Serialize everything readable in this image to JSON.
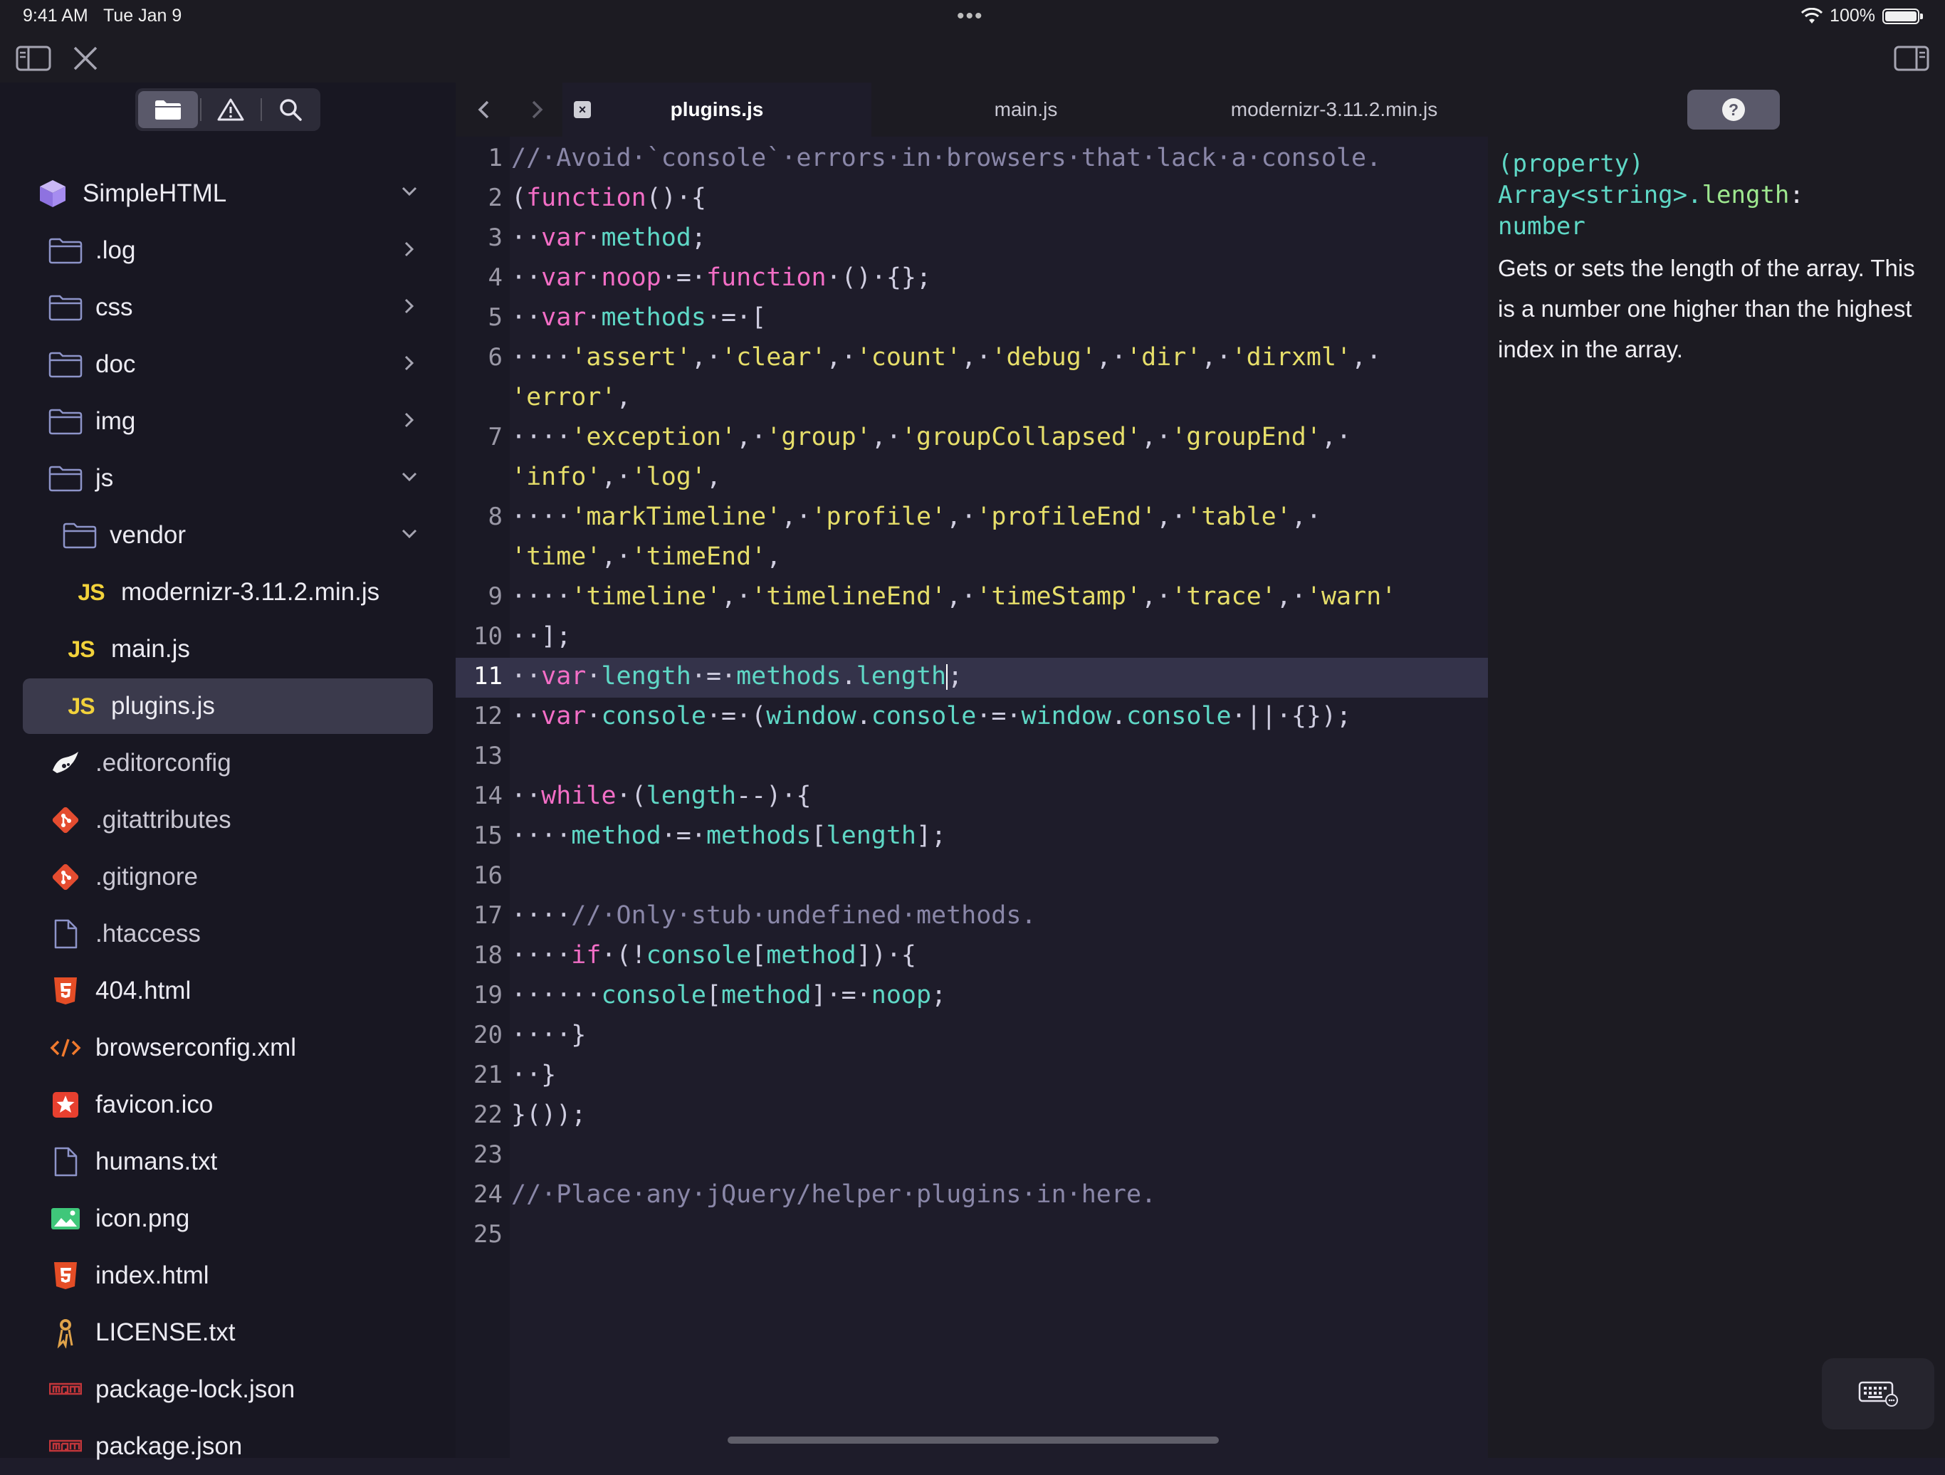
{
  "status": {
    "time": "9:41 AM",
    "date": "Tue Jan 9",
    "dots": "•••",
    "battery": "100%",
    "battery_level": 1.0
  },
  "toolbar": {
    "left_icons": [
      "sidebar-toggle-icon",
      "close-icon"
    ],
    "right_icons": [
      "right-panel-toggle-icon"
    ]
  },
  "sidebar": {
    "tabs": [
      {
        "icon": "folder-icon",
        "active": true
      },
      {
        "icon": "warning-icon",
        "active": false
      },
      {
        "icon": "search-icon",
        "active": false
      }
    ],
    "project": "SimpleHTML",
    "tree": [
      {
        "label": ".log",
        "icon": "folder-icon",
        "indent": 0,
        "chevron": "right"
      },
      {
        "label": "css",
        "icon": "folder-icon",
        "indent": 0,
        "chevron": "right"
      },
      {
        "label": "doc",
        "icon": "folder-icon",
        "indent": 0,
        "chevron": "right"
      },
      {
        "label": "img",
        "icon": "folder-icon",
        "indent": 0,
        "chevron": "right"
      },
      {
        "label": "js",
        "icon": "folder-icon",
        "indent": 0,
        "chevron": "down"
      },
      {
        "label": "vendor",
        "icon": "folder-icon",
        "indent": 1,
        "chevron": "down"
      },
      {
        "label": "modernizr-3.11.2.min.js",
        "icon": "js-file-icon",
        "indent": 2
      },
      {
        "label": "main.js",
        "icon": "js-file-icon",
        "indent": 1
      },
      {
        "label": "plugins.js",
        "icon": "js-file-icon",
        "indent": 1,
        "selected": true
      },
      {
        "label": ".editorconfig",
        "icon": "editorconfig-icon",
        "indent": 0,
        "dim": true
      },
      {
        "label": ".gitattributes",
        "icon": "git-icon",
        "indent": 0,
        "dim": true
      },
      {
        "label": ".gitignore",
        "icon": "git-icon",
        "indent": 0,
        "dim": true
      },
      {
        "label": ".htaccess",
        "icon": "file-icon",
        "indent": 0,
        "dim": true
      },
      {
        "label": "404.html",
        "icon": "html5-icon",
        "indent": 0
      },
      {
        "label": "browserconfig.xml",
        "icon": "xml-icon",
        "indent": 0
      },
      {
        "label": "favicon.ico",
        "icon": "favicon-icon",
        "indent": 0
      },
      {
        "label": "humans.txt",
        "icon": "file-icon",
        "indent": 0
      },
      {
        "label": "icon.png",
        "icon": "image-icon",
        "indent": 0
      },
      {
        "label": "index.html",
        "icon": "html5-icon",
        "indent": 0
      },
      {
        "label": "LICENSE.txt",
        "icon": "license-icon",
        "indent": 0
      },
      {
        "label": "package-lock.json",
        "icon": "npm-icon",
        "indent": 0
      },
      {
        "label": "package.json",
        "icon": "npm-icon",
        "indent": 0
      }
    ]
  },
  "editor": {
    "nav_icons": [
      "back-icon",
      "forward-icon"
    ],
    "tabs": [
      {
        "label": "plugins.js",
        "active": true,
        "close": "×"
      },
      {
        "label": "main.js",
        "active": false
      },
      {
        "label": "modernizr-3.11.2.min.js",
        "active": false
      }
    ],
    "current_line": 11,
    "lines": [
      {
        "n": "1",
        "tokens": [
          [
            "cmt",
            "//·Avoid·`console`·errors·in·browsers·that·lack·a·console."
          ]
        ]
      },
      {
        "n": "2",
        "tokens": [
          [
            "op",
            "("
          ],
          [
            "fn",
            "function"
          ],
          [
            "op",
            "()·{"
          ]
        ]
      },
      {
        "n": "3",
        "tokens": [
          [
            "op",
            "··"
          ],
          [
            "kw",
            "var"
          ],
          [
            "op",
            "·"
          ],
          [
            "ident",
            "method"
          ],
          [
            "op",
            ";"
          ]
        ]
      },
      {
        "n": "4",
        "tokens": [
          [
            "op",
            "··"
          ],
          [
            "kw",
            "var"
          ],
          [
            "op",
            "·"
          ],
          [
            "fn",
            "noop"
          ],
          [
            "op",
            "·=·"
          ],
          [
            "fn",
            "function"
          ],
          [
            "op",
            "·()·{};"
          ]
        ]
      },
      {
        "n": "5",
        "tokens": [
          [
            "op",
            "··"
          ],
          [
            "kw",
            "var"
          ],
          [
            "op",
            "·"
          ],
          [
            "ident",
            "methods"
          ],
          [
            "op",
            "·=·["
          ]
        ]
      },
      {
        "n": "6",
        "tokens": [
          [
            "op",
            "····"
          ],
          [
            "str",
            "'assert'"
          ],
          [
            "op",
            ",·"
          ],
          [
            "str",
            "'clear'"
          ],
          [
            "op",
            ",·"
          ],
          [
            "str",
            "'count'"
          ],
          [
            "op",
            ",·"
          ],
          [
            "str",
            "'debug'"
          ],
          [
            "op",
            ",·"
          ],
          [
            "str",
            "'dir'"
          ],
          [
            "op",
            ",·"
          ],
          [
            "str",
            "'dirxml'"
          ],
          [
            "op",
            ",·"
          ]
        ]
      },
      {
        "n": "",
        "tokens": [
          [
            "str",
            "'error'"
          ],
          [
            "op",
            ","
          ]
        ]
      },
      {
        "n": "7",
        "tokens": [
          [
            "op",
            "····"
          ],
          [
            "str",
            "'exception'"
          ],
          [
            "op",
            ",·"
          ],
          [
            "str",
            "'group'"
          ],
          [
            "op",
            ",·"
          ],
          [
            "str",
            "'groupCollapsed'"
          ],
          [
            "op",
            ",·"
          ],
          [
            "str",
            "'groupEnd'"
          ],
          [
            "op",
            ",·"
          ]
        ]
      },
      {
        "n": "",
        "tokens": [
          [
            "str",
            "'info'"
          ],
          [
            "op",
            ",·"
          ],
          [
            "str",
            "'log'"
          ],
          [
            "op",
            ","
          ]
        ]
      },
      {
        "n": "8",
        "tokens": [
          [
            "op",
            "····"
          ],
          [
            "str",
            "'markTimeline'"
          ],
          [
            "op",
            ",·"
          ],
          [
            "str",
            "'profile'"
          ],
          [
            "op",
            ",·"
          ],
          [
            "str",
            "'profileEnd'"
          ],
          [
            "op",
            ",·"
          ],
          [
            "str",
            "'table'"
          ],
          [
            "op",
            ",·"
          ]
        ]
      },
      {
        "n": "",
        "tokens": [
          [
            "str",
            "'time'"
          ],
          [
            "op",
            ",·"
          ],
          [
            "str",
            "'timeEnd'"
          ],
          [
            "op",
            ","
          ]
        ]
      },
      {
        "n": "9",
        "tokens": [
          [
            "op",
            "····"
          ],
          [
            "str",
            "'timeline'"
          ],
          [
            "op",
            ",·"
          ],
          [
            "str",
            "'timelineEnd'"
          ],
          [
            "op",
            ",·"
          ],
          [
            "str",
            "'timeStamp'"
          ],
          [
            "op",
            ",·"
          ],
          [
            "str",
            "'trace'"
          ],
          [
            "op",
            ",·"
          ],
          [
            "str",
            "'warn'"
          ]
        ]
      },
      {
        "n": "10",
        "tokens": [
          [
            "op",
            "··];"
          ]
        ]
      },
      {
        "n": "11",
        "tokens": [
          [
            "op",
            "··"
          ],
          [
            "kw",
            "var"
          ],
          [
            "op",
            "·"
          ],
          [
            "ident",
            "length"
          ],
          [
            "op",
            "·=·"
          ],
          [
            "ident",
            "methods"
          ],
          [
            "op",
            "."
          ],
          [
            "ident",
            "length"
          ],
          [
            "cursor",
            ""
          ],
          [
            "op",
            ";"
          ]
        ],
        "current": true
      },
      {
        "n": "12",
        "tokens": [
          [
            "op",
            "··"
          ],
          [
            "kw",
            "var"
          ],
          [
            "op",
            "·"
          ],
          [
            "ident",
            "console"
          ],
          [
            "op",
            "·=·("
          ],
          [
            "ident",
            "window"
          ],
          [
            "op",
            "."
          ],
          [
            "ident",
            "console"
          ],
          [
            "op",
            "·=·"
          ],
          [
            "ident",
            "window"
          ],
          [
            "op",
            "."
          ],
          [
            "ident",
            "console"
          ],
          [
            "op",
            "·||·{});"
          ]
        ]
      },
      {
        "n": "13",
        "tokens": []
      },
      {
        "n": "14",
        "tokens": [
          [
            "op",
            "··"
          ],
          [
            "kw",
            "while"
          ],
          [
            "op",
            "·("
          ],
          [
            "ident",
            "length"
          ],
          [
            "op",
            "--)·{"
          ]
        ]
      },
      {
        "n": "15",
        "tokens": [
          [
            "op",
            "····"
          ],
          [
            "ident",
            "method"
          ],
          [
            "op",
            "·=·"
          ],
          [
            "ident",
            "methods"
          ],
          [
            "op",
            "["
          ],
          [
            "ident",
            "length"
          ],
          [
            "op",
            "];"
          ]
        ]
      },
      {
        "n": "16",
        "tokens": []
      },
      {
        "n": "17",
        "tokens": [
          [
            "op",
            "····"
          ],
          [
            "cmt",
            "//·Only·stub·undefined·methods."
          ]
        ]
      },
      {
        "n": "18",
        "tokens": [
          [
            "op",
            "····"
          ],
          [
            "kw",
            "if"
          ],
          [
            "op",
            "·(!"
          ],
          [
            "ident",
            "console"
          ],
          [
            "op",
            "["
          ],
          [
            "ident",
            "method"
          ],
          [
            "op",
            "])·{"
          ]
        ]
      },
      {
        "n": "19",
        "tokens": [
          [
            "op",
            "······"
          ],
          [
            "ident",
            "console"
          ],
          [
            "op",
            "["
          ],
          [
            "ident",
            "method"
          ],
          [
            "op",
            "]·=·"
          ],
          [
            "ident",
            "noop"
          ],
          [
            "op",
            ";"
          ]
        ]
      },
      {
        "n": "20",
        "tokens": [
          [
            "op",
            "····}"
          ]
        ]
      },
      {
        "n": "21",
        "tokens": [
          [
            "op",
            "··}"
          ]
        ]
      },
      {
        "n": "22",
        "tokens": [
          [
            "op",
            "}());"
          ]
        ]
      },
      {
        "n": "23",
        "tokens": []
      },
      {
        "n": "24",
        "tokens": [
          [
            "cmt",
            "//·Place·any·jQuery/helper·plugins·in·here."
          ]
        ]
      },
      {
        "n": "25",
        "tokens": []
      }
    ]
  },
  "help": {
    "sig_prefix": "(property)",
    "sig_type": "Array<string>.",
    "sig_prop": "length",
    "sig_colon": ":",
    "sig_return": "number",
    "description": "Gets or sets the length of the array. This is a number one higher than the highest index in the array."
  },
  "colors": {
    "accent_js": "#f2d23b",
    "keyword": "#f36ec6",
    "identifier": "#5fd8c6",
    "string": "#e6de6a",
    "comment": "#8a87a8"
  }
}
